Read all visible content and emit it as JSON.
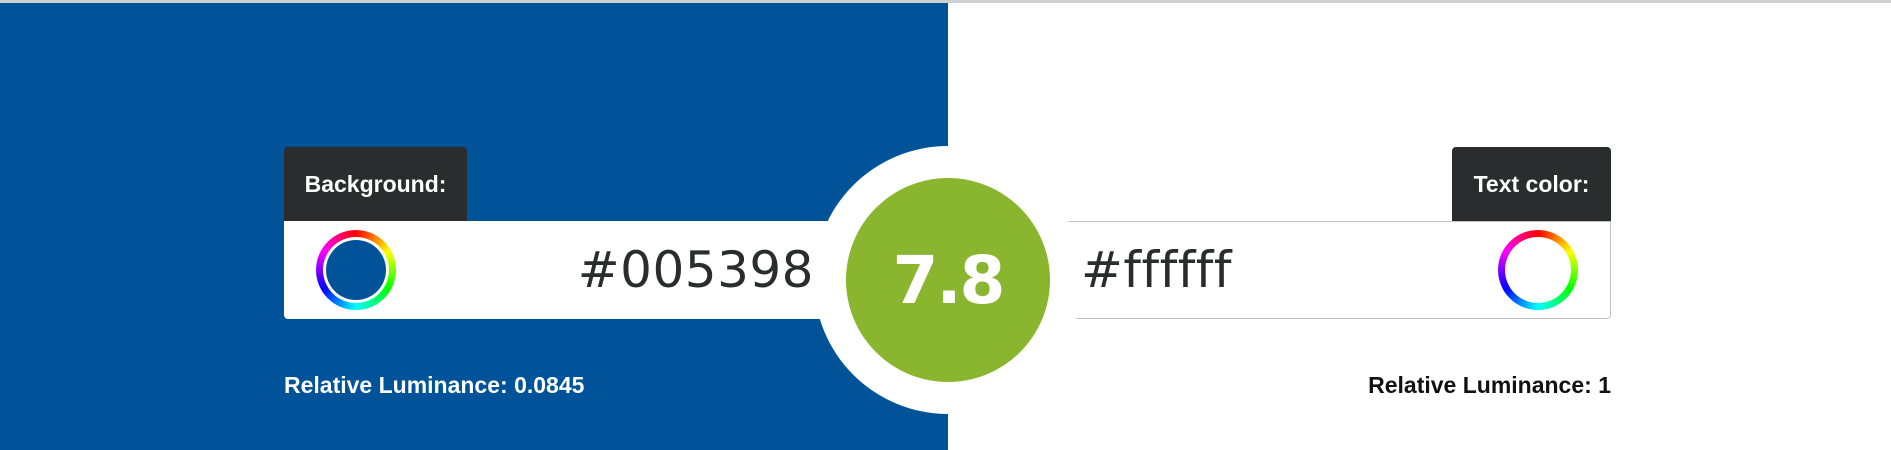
{
  "background": {
    "tab_label": "Background:",
    "hex": "#005398",
    "swatch_color": "#005398",
    "luminance_label": "Relative Luminance:",
    "luminance_value": "0.0845"
  },
  "text_color": {
    "tab_label": "Text color:",
    "hex": "#ffffff",
    "swatch_color": "#ffffff",
    "luminance_label": "Relative Luminance:",
    "luminance_value": "1"
  },
  "contrast": {
    "ratio": "7.8",
    "badge_color": "#8ab52f"
  },
  "icons": {
    "background_picker": "color-wheel-icon",
    "text_picker": "color-wheel-icon"
  }
}
